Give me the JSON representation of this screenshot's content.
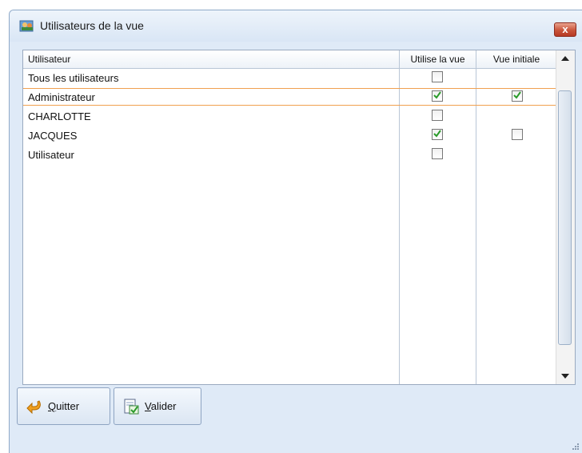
{
  "window": {
    "title": "Utilisateurs de la vue",
    "close_label": "x"
  },
  "grid": {
    "columns": [
      "Utilisateur",
      "Utilise la vue",
      "Vue initiale"
    ],
    "rows": [
      {
        "name": "Tous les utilisateurs",
        "uses_view": false,
        "initial_view": null
      },
      {
        "name": "Administrateur",
        "uses_view": true,
        "initial_view": true,
        "selected": true
      },
      {
        "name": "CHARLOTTE",
        "uses_view": false,
        "initial_view": null
      },
      {
        "name": "JACQUES",
        "uses_view": true,
        "initial_view": false
      },
      {
        "name": "Utilisateur",
        "uses_view": false,
        "initial_view": null
      }
    ]
  },
  "buttons": {
    "quit": {
      "accel": "Q",
      "rest": "uitter",
      "icon": "back-arrow-icon"
    },
    "validate": {
      "accel": "V",
      "rest": "alider",
      "icon": "validate-document-icon"
    }
  },
  "colors": {
    "selection_border": "#f0a050",
    "checkmark": "#2a9a2a",
    "close_button": "#c9543a"
  }
}
